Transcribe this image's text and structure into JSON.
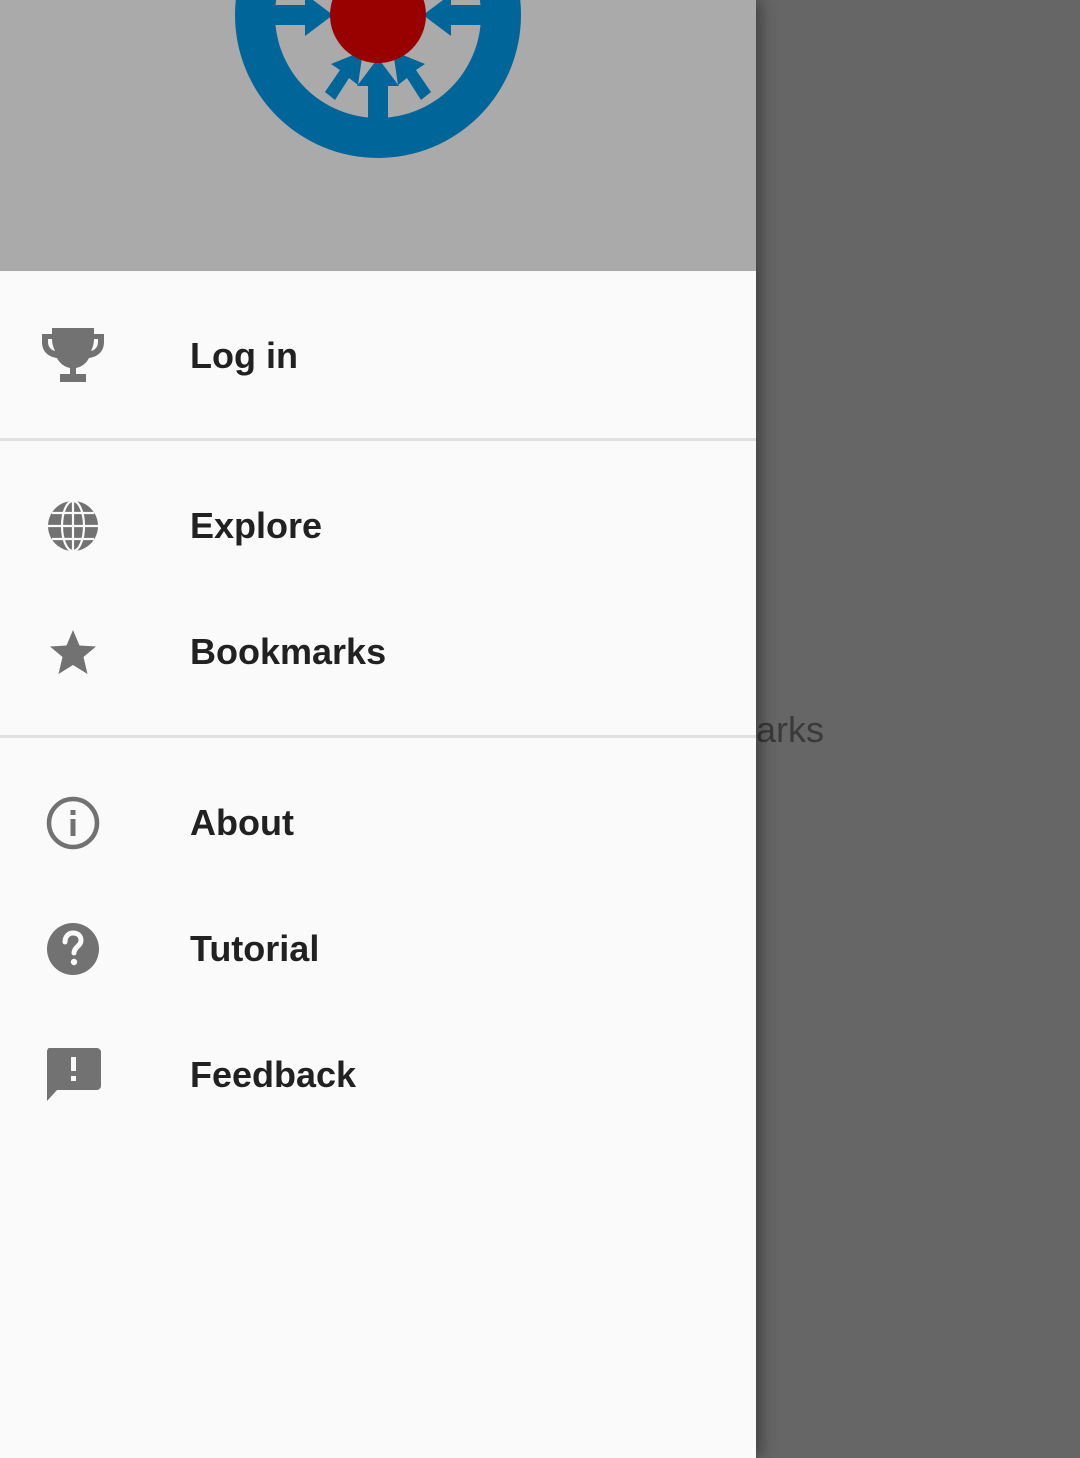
{
  "background": {
    "partial_text": "arks"
  },
  "drawer": {
    "header": {
      "logo_icon": "compass-logo"
    },
    "items": [
      {
        "label": "Log in",
        "icon": "trophy-icon"
      },
      {
        "label": "Explore",
        "icon": "globe-icon"
      },
      {
        "label": "Bookmarks",
        "icon": "star-icon"
      },
      {
        "label": "About",
        "icon": "info-icon"
      },
      {
        "label": "Tutorial",
        "icon": "help-icon"
      },
      {
        "label": "Feedback",
        "icon": "feedback-icon"
      }
    ]
  },
  "colors": {
    "header_bg": "#aaaaaa",
    "drawer_bg": "#fafafa",
    "scrim": "#666666",
    "logo_blue": "#006699",
    "logo_red": "#990000",
    "icon_gray": "#727272",
    "label_text": "#212121",
    "divider": "#e0e0e0"
  }
}
